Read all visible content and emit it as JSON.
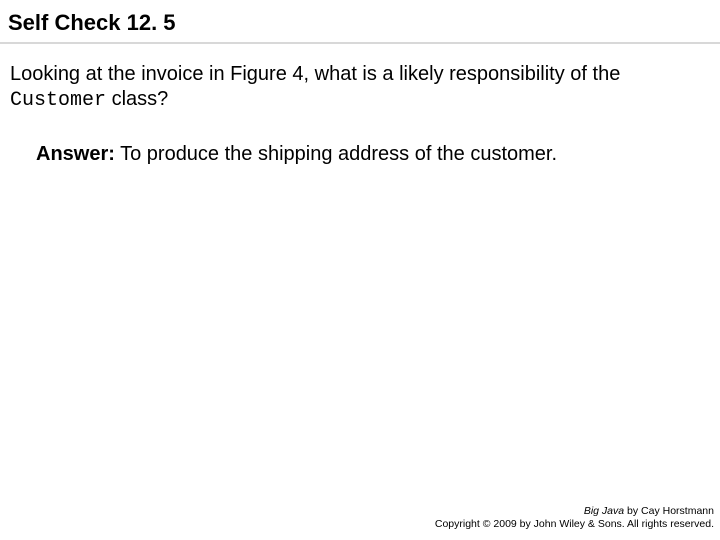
{
  "title": "Self Check 12. 5",
  "question_part1": "Looking at the invoice in Figure 4, what is a likely responsibility of the ",
  "question_code": "Customer",
  "question_part2": " class?",
  "answer_label": "Answer:",
  "answer_text": " To produce the shipping address of the customer.",
  "footer_book": "Big Java",
  "footer_author": " by Cay Horstmann",
  "footer_copyright": "Copyright © 2009 by John Wiley & Sons.  All rights reserved."
}
